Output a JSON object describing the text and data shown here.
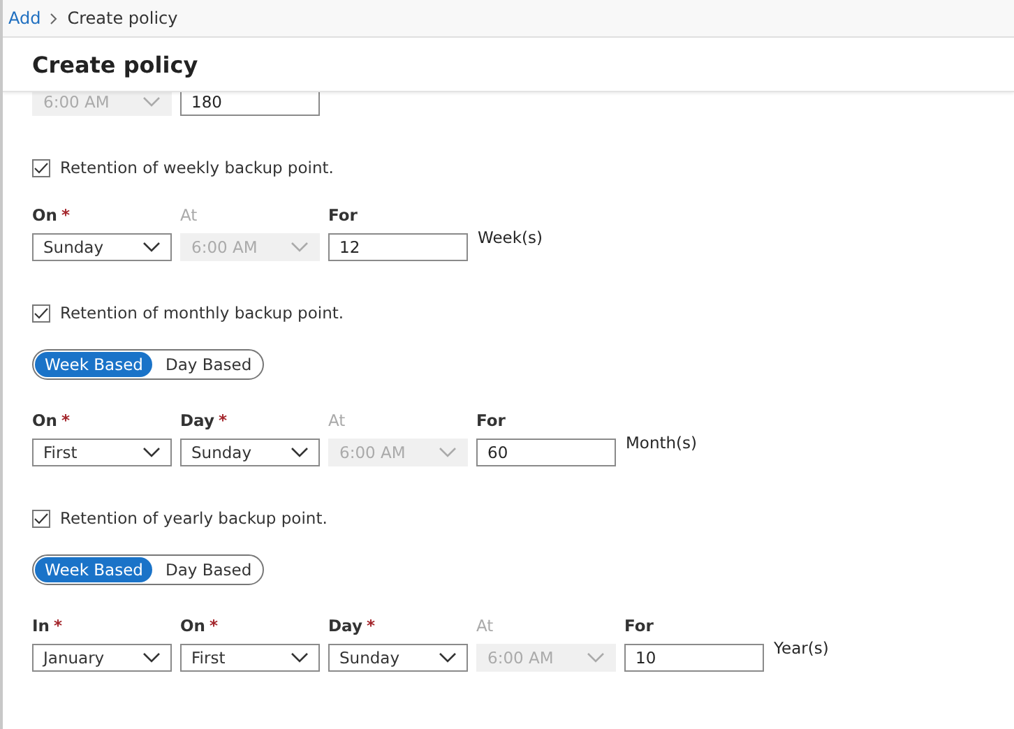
{
  "breadcrumb": {
    "link": "Add",
    "current": "Create policy"
  },
  "title": "Create policy",
  "partial_row": {
    "fields": [
      {
        "kind": "dropdown",
        "value": "6:00 AM",
        "disabled": true
      },
      {
        "kind": "input",
        "value": "180",
        "disabled": false
      }
    ]
  },
  "sections": [
    {
      "checkbox": {
        "label": "Retention of weekly backup point.",
        "checked": true
      },
      "fields": [
        {
          "label": "On",
          "required_mark": "*",
          "kind": "dropdown",
          "value": "Sunday",
          "disabled": false
        },
        {
          "label": "At",
          "kind": "dropdown",
          "value": "6:00 AM",
          "disabled": true
        },
        {
          "label": "For",
          "kind": "input",
          "value": "12",
          "disabled": false
        }
      ],
      "unit": "Week(s)"
    },
    {
      "checkbox": {
        "label": "Retention of monthly backup point.",
        "checked": true
      },
      "toggle": [
        {
          "label": "Week Based",
          "selected": true
        },
        {
          "label": "Day Based",
          "selected": false
        }
      ],
      "fields": [
        {
          "label": "On",
          "required_mark": "*",
          "kind": "dropdown",
          "value": "First",
          "disabled": false
        },
        {
          "label": "Day",
          "required_mark": "*",
          "kind": "dropdown",
          "value": "Sunday",
          "disabled": false
        },
        {
          "label": "At",
          "kind": "dropdown",
          "value": "6:00 AM",
          "disabled": true
        },
        {
          "label": "For",
          "kind": "input",
          "value": "60",
          "disabled": false
        }
      ],
      "unit": "Month(s)"
    },
    {
      "checkbox": {
        "label": "Retention of yearly backup point.",
        "checked": true
      },
      "toggle": [
        {
          "label": "Week Based",
          "selected": true
        },
        {
          "label": "Day Based",
          "selected": false
        }
      ],
      "fields": [
        {
          "label": "In",
          "required_mark": "*",
          "kind": "dropdown",
          "value": "January",
          "disabled": false
        },
        {
          "label": "On",
          "required_mark": "*",
          "kind": "dropdown",
          "value": "First",
          "disabled": false
        },
        {
          "label": "Day",
          "required_mark": "*",
          "kind": "dropdown",
          "value": "Sunday",
          "disabled": false
        },
        {
          "label": "At",
          "kind": "dropdown",
          "value": "6:00 AM",
          "disabled": true
        },
        {
          "label": "For",
          "kind": "input",
          "value": "10",
          "disabled": false
        }
      ],
      "unit": "Year(s)"
    }
  ]
}
